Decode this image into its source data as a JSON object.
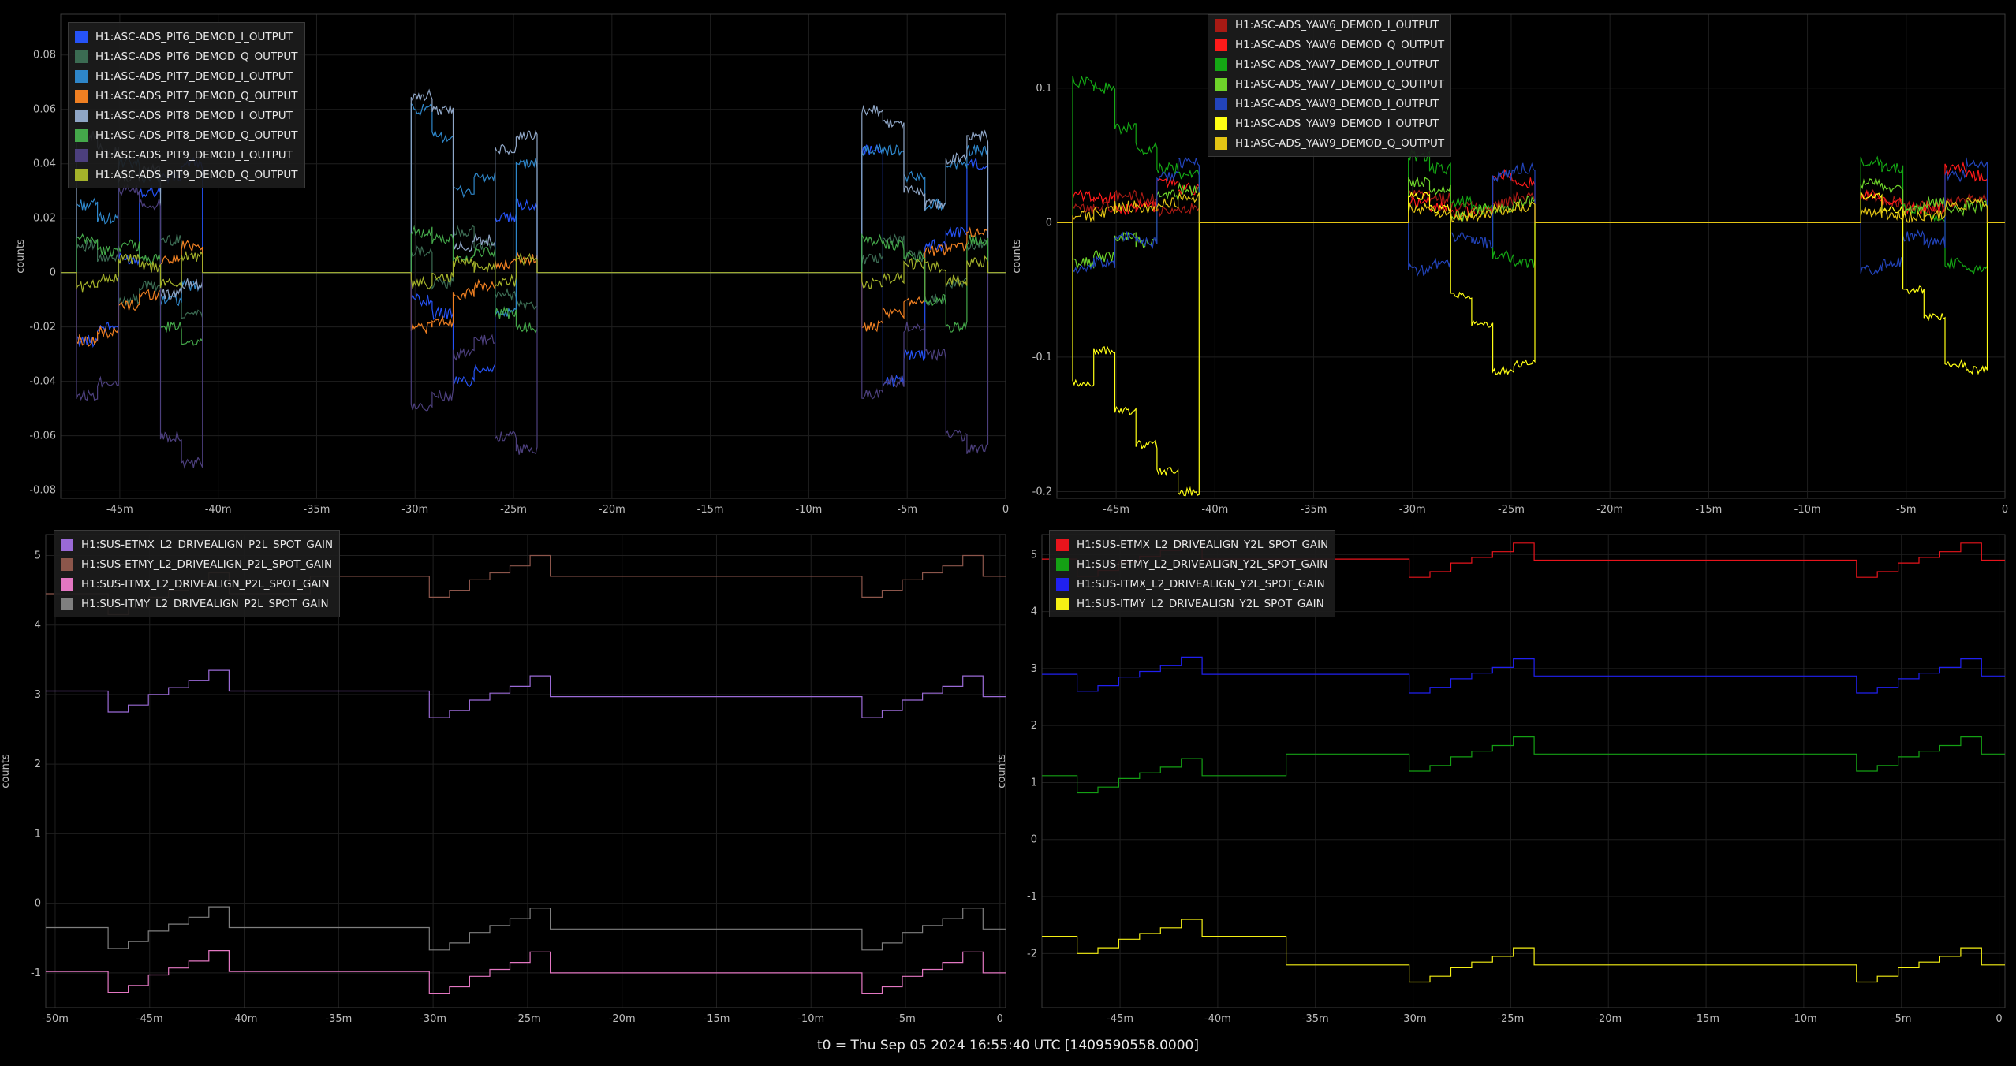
{
  "footer": {
    "text": "t0 = Thu Sep 05 2024 16:55:40 UTC [1409590558.0000]"
  },
  "chart_data": [
    {
      "type": "line",
      "id": "pit-demod",
      "ylabel": "counts",
      "xlim": [
        -48,
        0
      ],
      "ylim": [
        -0.083,
        0.095
      ],
      "xticks": [
        -45,
        -40,
        -35,
        -30,
        -25,
        -20,
        -15,
        -10,
        -5,
        0
      ],
      "xtick_labels": [
        "-45m",
        "-40m",
        "-35m",
        "-30m",
        "-25m",
        "-20m",
        "-15m",
        "-10m",
        "-5m",
        "0"
      ],
      "yticks": [
        -0.08,
        -0.06,
        -0.04,
        -0.02,
        0,
        0.02,
        0.04,
        0.06,
        0.08
      ],
      "ytick_labels": [
        "-0.08",
        "-0.06",
        "-0.04",
        "-0.02",
        "0",
        "0.02",
        "0.04",
        "0.06",
        "0.08"
      ],
      "grid": true,
      "legend_position": "top-left",
      "series": [
        {
          "name": "H1:ASC-ADS_PIT6_DEMOD_I_OUTPUT",
          "color": "#2653f7",
          "style": "demod",
          "levels": [
            -0.025,
            -0.02,
            0.005,
            0.03,
            0.035,
            0.04,
            -0.01,
            -0.015,
            -0.04,
            -0.035,
            0.02,
            0.025,
            0.045,
            -0.04,
            -0.03,
            0.01,
            0.015,
            0.04
          ]
        },
        {
          "name": "H1:ASC-ADS_PIT6_DEMOD_Q_OUTPUT",
          "color": "#3b6b52",
          "style": "demod",
          "levels": [
            0.01,
            0.005,
            -0.01,
            -0.005,
            0.012,
            -0.015,
            0.008,
            -0.004,
            0.015,
            0.01,
            -0.008,
            -0.012,
            0.005,
            0.012,
            0.006,
            -0.01,
            -0.004,
            0.01
          ]
        },
        {
          "name": "H1:ASC-ADS_PIT7_DEMOD_I_OUTPUT",
          "color": "#2e86c9",
          "style": "demod",
          "levels": [
            0.025,
            0.02,
            0.04,
            0.035,
            -0.01,
            -0.005,
            0.06,
            0.05,
            0.03,
            0.035,
            -0.015,
            0.04,
            0.045,
            0.045,
            0.035,
            0.025,
            0.04,
            0.045
          ]
        },
        {
          "name": "H1:ASC-ADS_PIT7_DEMOD_Q_OUTPUT",
          "color": "#f08022",
          "style": "demod",
          "levels": [
            -0.025,
            -0.022,
            -0.012,
            -0.008,
            0.005,
            0.01,
            -0.02,
            -0.018,
            -0.008,
            -0.005,
            0.003,
            0.005,
            -0.02,
            -0.015,
            -0.01,
            0.008,
            0.01,
            0.015
          ]
        },
        {
          "name": "H1:ASC-ADS_PIT8_DEMOD_I_OUTPUT",
          "color": "#8fa6c6",
          "style": "demod",
          "levels": [
            0.05,
            0.045,
            0.035,
            0.038,
            -0.008,
            -0.004,
            0.065,
            0.06,
            0.01,
            0.012,
            0.045,
            0.05,
            0.06,
            0.055,
            0.03,
            0.025,
            0.042,
            0.05
          ]
        },
        {
          "name": "H1:ASC-ADS_PIT8_DEMOD_Q_OUTPUT",
          "color": "#44a84a",
          "style": "demod",
          "levels": [
            0.012,
            0.008,
            0.01,
            0.005,
            -0.02,
            -0.025,
            0.015,
            0.012,
            0.005,
            0.008,
            -0.015,
            -0.02,
            0.012,
            0.01,
            0.006,
            -0.01,
            -0.02,
            0.012
          ]
        },
        {
          "name": "H1:ASC-ADS_PIT9_DEMOD_I_OUTPUT",
          "color": "#4c3f7d",
          "style": "demod",
          "levels": [
            -0.045,
            -0.04,
            0.03,
            0.025,
            -0.06,
            -0.07,
            -0.05,
            -0.045,
            -0.03,
            -0.025,
            -0.06,
            -0.065,
            -0.045,
            -0.04,
            -0.02,
            -0.03,
            -0.06,
            -0.065
          ]
        },
        {
          "name": "H1:ASC-ADS_PIT9_DEMOD_Q_OUTPUT",
          "color": "#a4b22a",
          "style": "demod",
          "levels": [
            -0.005,
            -0.002,
            0.005,
            0.002,
            -0.004,
            0.006,
            -0.004,
            -0.002,
            0.004,
            0.002,
            -0.003,
            0.005,
            -0.004,
            -0.002,
            0.003,
            0.002,
            -0.003,
            0.004
          ]
        }
      ]
    },
    {
      "type": "line",
      "id": "yaw-demod",
      "ylabel": "counts",
      "xlim": [
        -48,
        0
      ],
      "ylim": [
        -0.205,
        0.155
      ],
      "xticks": [
        -45,
        -40,
        -35,
        -30,
        -25,
        -20,
        -15,
        -10,
        -5,
        0
      ],
      "xtick_labels": [
        "-45m",
        "-40m",
        "-35m",
        "-30m",
        "-25m",
        "-20m",
        "-15m",
        "-10m",
        "-5m",
        "0"
      ],
      "yticks": [
        -0.2,
        -0.1,
        0,
        0.1
      ],
      "ytick_labels": [
        "-0.2",
        "-0.1",
        "0",
        "0.1"
      ],
      "grid": true,
      "legend_position": "top-center",
      "series": [
        {
          "name": "H1:ASC-ADS_YAW6_DEMOD_I_OUTPUT",
          "color": "#a81a14",
          "style": "demod",
          "levels": [
            0.01,
            0.012,
            0.02,
            0.018,
            0.008,
            0.01,
            0.02,
            0.018,
            0.012,
            0.01,
            0.015,
            0.018,
            0.02,
            0.016,
            0.012,
            0.01,
            0.015,
            0.018
          ]
        },
        {
          "name": "H1:ASC-ADS_YAW6_DEMOD_Q_OUTPUT",
          "color": "#ff1a1a",
          "style": "demod",
          "levels": [
            0.02,
            0.018,
            0.01,
            0.012,
            0.03,
            0.025,
            0.015,
            0.012,
            0.008,
            0.01,
            0.035,
            0.03,
            0.02,
            0.015,
            0.01,
            0.012,
            0.04,
            0.035
          ]
        },
        {
          "name": "H1:ASC-ADS_YAW7_DEMOD_I_OUTPUT",
          "color": "#14a814",
          "style": "demod",
          "levels": [
            0.105,
            0.1,
            0.07,
            0.055,
            0.04,
            0.035,
            0.05,
            0.04,
            0.015,
            0.01,
            -0.025,
            -0.03,
            0.045,
            0.04,
            0.01,
            0.005,
            -0.03,
            -0.035
          ]
        },
        {
          "name": "H1:ASC-ADS_YAW7_DEMOD_Q_OUTPUT",
          "color": "#6ed42a",
          "style": "demod",
          "levels": [
            -0.03,
            -0.025,
            -0.01,
            -0.015,
            0.02,
            0.025,
            0.03,
            0.025,
            0.005,
            0.01,
            0.01,
            0.015,
            0.03,
            0.025,
            0.01,
            0.015,
            0.01,
            0.012
          ]
        },
        {
          "name": "H1:ASC-ADS_YAW8_DEMOD_I_OUTPUT",
          "color": "#2244bb",
          "style": "demod",
          "levels": [
            -0.035,
            -0.03,
            -0.01,
            -0.015,
            0.035,
            0.045,
            -0.035,
            -0.03,
            -0.01,
            -0.015,
            0.035,
            0.04,
            -0.035,
            -0.03,
            -0.01,
            -0.015,
            0.035,
            0.045
          ]
        },
        {
          "name": "H1:ASC-ADS_YAW9_DEMOD_I_OUTPUT",
          "color": "#ffff14",
          "style": "yellowI",
          "levels": [
            -0.12,
            -0.095,
            -0.14,
            -0.165,
            -0.185,
            -0.2,
            0.02,
            0.01,
            -0.055,
            -0.075,
            -0.11,
            -0.105,
            0.02,
            0.01,
            -0.05,
            -0.07,
            -0.105,
            -0.11
          ]
        },
        {
          "name": "H1:ASC-ADS_YAW9_DEMOD_Q_OUTPUT",
          "color": "#e3c414",
          "style": "demod",
          "levels": [
            0.005,
            0.008,
            0.012,
            0.01,
            0.015,
            0.018,
            0.01,
            0.008,
            0.004,
            0.006,
            0.01,
            0.012,
            0.008,
            0.006,
            0.004,
            0.005,
            0.012,
            0.015
          ]
        }
      ]
    },
    {
      "type": "line",
      "id": "p2l-spot-gain",
      "ylabel": "counts",
      "xlim": [
        -50.5,
        0.3
      ],
      "ylim": [
        -1.5,
        5.3
      ],
      "xticks": [
        -50,
        -45,
        -40,
        -35,
        -30,
        -25,
        -20,
        -15,
        -10,
        -5,
        0
      ],
      "xtick_labels": [
        "-50m",
        "-45m",
        "-40m",
        "-35m",
        "-30m",
        "-25m",
        "-20m",
        "-15m",
        "-10m",
        "-5m",
        "0"
      ],
      "yticks": [
        -1,
        0,
        1,
        2,
        3,
        4,
        5
      ],
      "ytick_labels": [
        "-1",
        "0",
        "1",
        "2",
        "3",
        "4",
        "5"
      ],
      "grid": true,
      "legend_position": "top-left",
      "series": [
        {
          "name": "H1:SUS-ETMX_L2_DRIVEALIGN_P2L_SPOT_GAIN",
          "color": "#9a6ad6",
          "style": "steps",
          "base": 3.05,
          "amp": 0.3,
          "level2": 2.97,
          "shift_at": null
        },
        {
          "name": "H1:SUS-ETMY_L2_DRIVEALIGN_P2L_SPOT_GAIN",
          "color": "#8c564b",
          "style": "steps",
          "base": 4.45,
          "amp": 0.3,
          "level2": 4.7,
          "shift_at": -36.5
        },
        {
          "name": "H1:SUS-ITMX_L2_DRIVEALIGN_P2L_SPOT_GAIN",
          "color": "#e377c2",
          "style": "steps",
          "base": -0.98,
          "amp": 0.3,
          "level2": -1.0,
          "shift_at": null
        },
        {
          "name": "H1:SUS-ITMY_L2_DRIVEALIGN_P2L_SPOT_GAIN",
          "color": "#7f7f7f",
          "style": "steps",
          "base": -0.35,
          "amp": 0.3,
          "level2": -0.37,
          "shift_at": null
        }
      ]
    },
    {
      "type": "line",
      "id": "y2l-spot-gain",
      "ylabel": "counts",
      "xlim": [
        -49,
        0.3
      ],
      "ylim": [
        -2.95,
        5.35
      ],
      "xticks": [
        -45,
        -40,
        -35,
        -30,
        -25,
        -20,
        -15,
        -10,
        -5,
        0
      ],
      "xtick_labels": [
        "-45m",
        "-40m",
        "-35m",
        "-30m",
        "-25m",
        "-20m",
        "-15m",
        "-10m",
        "-5m",
        "0"
      ],
      "yticks": [
        -2,
        -1,
        0,
        1,
        2,
        3,
        4,
        5
      ],
      "ytick_labels": [
        "-2",
        "-1",
        "0",
        "1",
        "2",
        "3",
        "4",
        "5"
      ],
      "grid": true,
      "legend_position": "top-left",
      "series": [
        {
          "name": "H1:SUS-ETMX_L2_DRIVEALIGN_Y2L_SPOT_GAIN",
          "color": "#e8141c",
          "style": "steps",
          "base": 4.92,
          "amp": 0.3,
          "level2": 4.9,
          "shift_at": null
        },
        {
          "name": "H1:SUS-ETMY_L2_DRIVEALIGN_Y2L_SPOT_GAIN",
          "color": "#14a014",
          "style": "steps",
          "base": 1.12,
          "amp": 0.3,
          "level2": 1.5,
          "shift_at": -36.5
        },
        {
          "name": "H1:SUS-ITMX_L2_DRIVEALIGN_Y2L_SPOT_GAIN",
          "color": "#2020f0",
          "style": "steps",
          "base": 2.9,
          "amp": 0.3,
          "level2": 2.87,
          "shift_at": null
        },
        {
          "name": "H1:SUS-ITMY_L2_DRIVEALIGN_Y2L_SPOT_GAIN",
          "color": "#f5f014",
          "style": "steps",
          "base": -1.7,
          "amp": 0.3,
          "level2": -2.2,
          "shift_at": -36.5
        }
      ]
    }
  ]
}
